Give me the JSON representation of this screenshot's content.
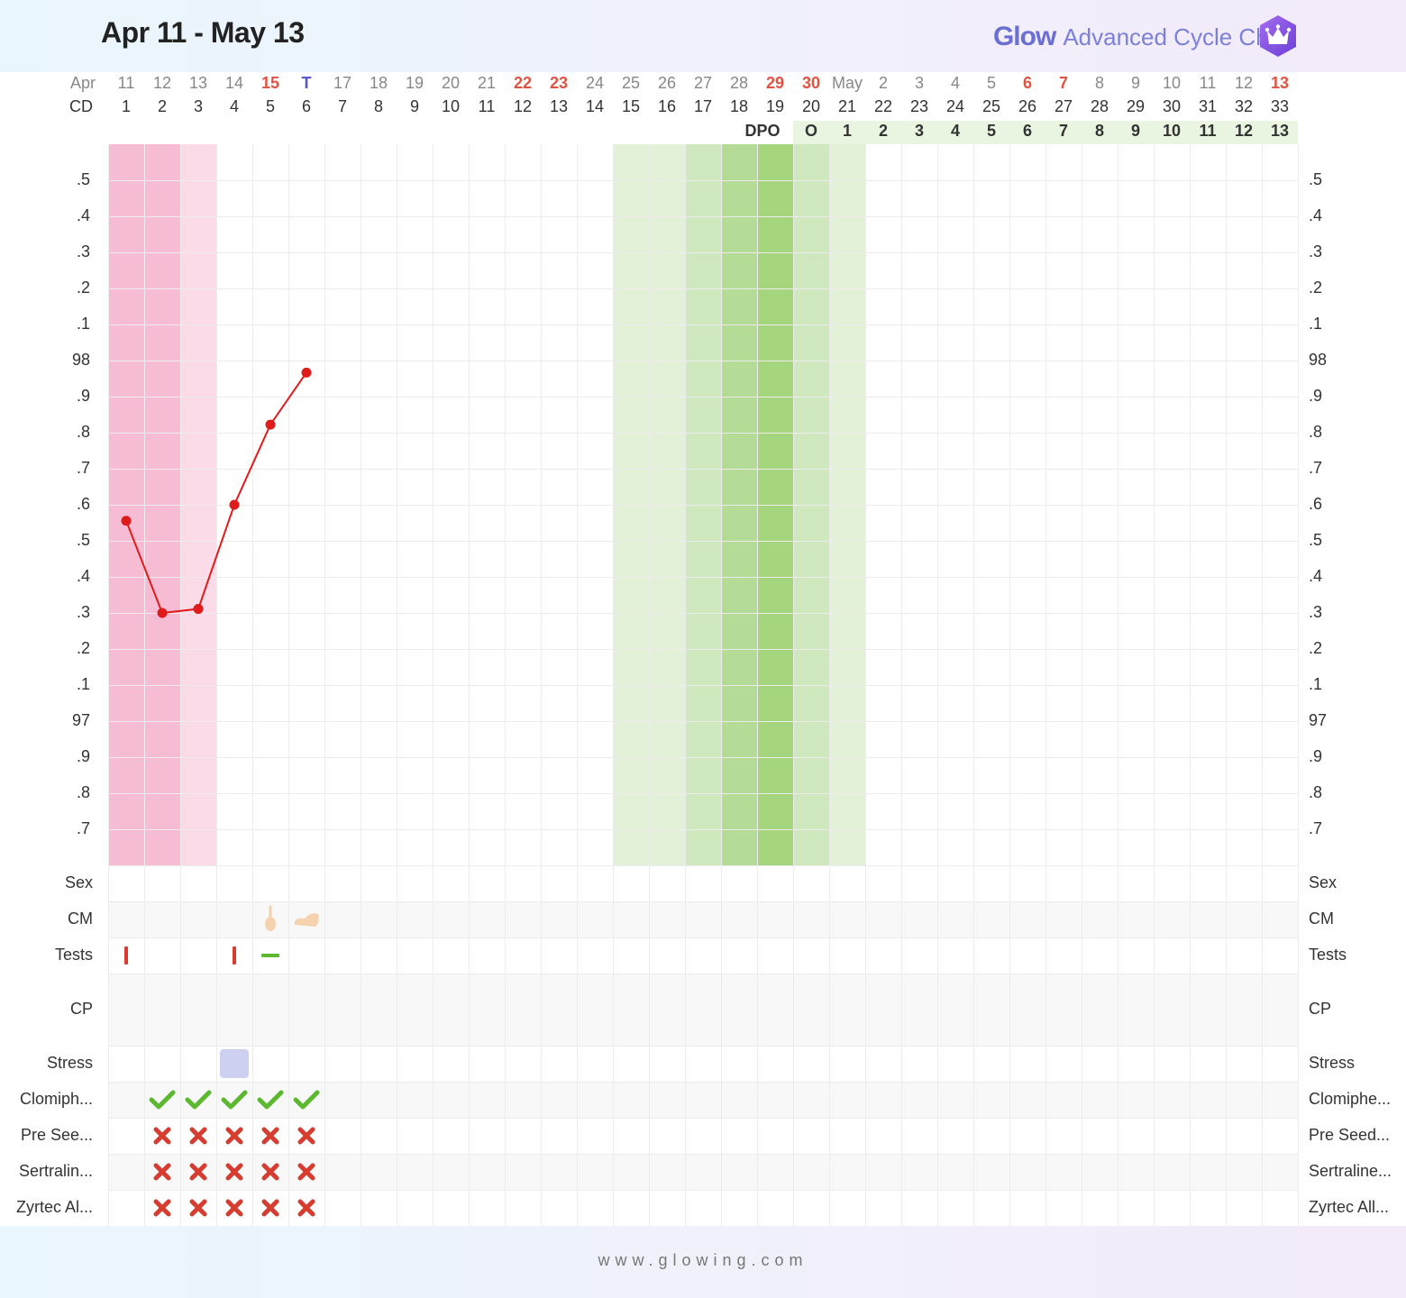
{
  "header": {
    "range_title": "Apr 11 - May 13",
    "brand_glow": "Glow",
    "brand_sub": "Advanced Cycle Chart",
    "crown_icon": "crown-icon"
  },
  "footer": {
    "url": "www.glowing.com"
  },
  "colors": {
    "period_heavy": "#f6bcd4",
    "period_light": "#fadbe7",
    "fertile_light": "#e2f1d7",
    "fertile_mid": "#cfe8be",
    "fertile_strong": "#b5dc97",
    "fertile_peak": "#a5d57d",
    "temp_line": "#e01b1b",
    "weekend_red": "#e05343",
    "today_blue": "#5555cc",
    "dpo_bg": "#eaf5e1",
    "check_green": "#5cb82f",
    "cross_red": "#d63c2f"
  },
  "chart_data": {
    "type": "line",
    "title": "Apr 11 - May 13",
    "row_labels": {
      "date": "Apr",
      "cd": "CD",
      "dpo": "DPO"
    },
    "dates": [
      "11",
      "12",
      "13",
      "14",
      "15",
      "T",
      "17",
      "18",
      "19",
      "20",
      "21",
      "22",
      "23",
      "24",
      "25",
      "26",
      "27",
      "28",
      "29",
      "30",
      "May",
      "2",
      "3",
      "4",
      "5",
      "6",
      "7",
      "8",
      "9",
      "10",
      "11",
      "12",
      "13"
    ],
    "date_styles": [
      "n",
      "n",
      "n",
      "n",
      "r",
      "b",
      "n",
      "n",
      "n",
      "n",
      "n",
      "r",
      "r",
      "n",
      "n",
      "n",
      "n",
      "n",
      "r",
      "r",
      "n",
      "n",
      "n",
      "n",
      "n",
      "r",
      "r",
      "n",
      "n",
      "n",
      "n",
      "n",
      "r"
    ],
    "cycle_days": [
      "1",
      "2",
      "3",
      "4",
      "5",
      "6",
      "7",
      "8",
      "9",
      "10",
      "11",
      "12",
      "13",
      "14",
      "15",
      "16",
      "17",
      "18",
      "19",
      "20",
      "21",
      "22",
      "23",
      "24",
      "25",
      "26",
      "27",
      "28",
      "29",
      "30",
      "31",
      "32",
      "33"
    ],
    "dpo_values": [
      "O",
      "1",
      "2",
      "3",
      "4",
      "5",
      "6",
      "7",
      "8",
      "9",
      "10",
      "11",
      "12",
      "13"
    ],
    "dpo_start_index": 19,
    "y_ticks": [
      ".5",
      ".4",
      ".3",
      ".2",
      ".1",
      "98",
      ".9",
      ".8",
      ".7",
      ".6",
      ".5",
      ".4",
      ".3",
      ".2",
      ".1",
      "97",
      ".9",
      ".8",
      ".7"
    ],
    "ylim": [
      96.7,
      98.5
    ],
    "temperatures": [
      {
        "day": 1,
        "value": 97.56
      },
      {
        "day": 2,
        "value": 97.33
      },
      {
        "day": 3,
        "value": 97.34
      },
      {
        "day": 4,
        "value": 97.6
      },
      {
        "day": 5,
        "value": 97.8
      },
      {
        "day": 6,
        "value": 97.93
      }
    ],
    "day_shading": [
      {
        "day": 1,
        "tone": "period_heavy"
      },
      {
        "day": 2,
        "tone": "period_heavy"
      },
      {
        "day": 3,
        "tone": "period_light"
      },
      {
        "day": 15,
        "tone": "fertile_light"
      },
      {
        "day": 16,
        "tone": "fertile_light"
      },
      {
        "day": 17,
        "tone": "fertile_mid"
      },
      {
        "day": 18,
        "tone": "fertile_strong"
      },
      {
        "day": 19,
        "tone": "fertile_peak"
      },
      {
        "day": 20,
        "tone": "fertile_mid"
      },
      {
        "day": 21,
        "tone": "fertile_light"
      }
    ],
    "grid": true
  },
  "symptoms": {
    "rows": [
      {
        "left": "Sex",
        "right": "Sex",
        "tall": false
      },
      {
        "left": "CM",
        "right": "CM",
        "tall": false
      },
      {
        "left": "Tests",
        "right": "Tests",
        "tall": false
      },
      {
        "left": "CP",
        "right": "CP",
        "tall": true
      },
      {
        "left": "Stress",
        "right": "Stress",
        "tall": false
      },
      {
        "left": "Clomiph...",
        "right": "Clomiphe...",
        "tall": false
      },
      {
        "left": "Pre See...",
        "right": "Pre Seed...",
        "tall": false
      },
      {
        "left": "Sertralin...",
        "right": "Sertraline...",
        "tall": false
      },
      {
        "left": "Zyrtec Al...",
        "right": "Zyrtec All...",
        "tall": false
      }
    ],
    "marks": [
      {
        "row": 1,
        "day": 5,
        "icon": "cervical-mucus-sticky-icon"
      },
      {
        "row": 1,
        "day": 6,
        "icon": "cervical-mucus-creamy-icon"
      },
      {
        "row": 2,
        "day": 1,
        "icon": "test-negative-red-bar-icon"
      },
      {
        "row": 2,
        "day": 4,
        "icon": "test-negative-red-bar-icon"
      },
      {
        "row": 2,
        "day": 5,
        "icon": "test-positive-green-bar-icon"
      },
      {
        "row": 4,
        "day": 4,
        "icon": "stress-level-icon"
      },
      {
        "row": 5,
        "day": 2,
        "icon": "check-icon"
      },
      {
        "row": 5,
        "day": 3,
        "icon": "check-icon"
      },
      {
        "row": 5,
        "day": 4,
        "icon": "check-icon"
      },
      {
        "row": 5,
        "day": 5,
        "icon": "check-icon"
      },
      {
        "row": 5,
        "day": 6,
        "icon": "check-icon"
      },
      {
        "row": 6,
        "day": 2,
        "icon": "cross-icon"
      },
      {
        "row": 6,
        "day": 3,
        "icon": "cross-icon"
      },
      {
        "row": 6,
        "day": 4,
        "icon": "cross-icon"
      },
      {
        "row": 6,
        "day": 5,
        "icon": "cross-icon"
      },
      {
        "row": 6,
        "day": 6,
        "icon": "cross-icon"
      },
      {
        "row": 7,
        "day": 2,
        "icon": "cross-icon"
      },
      {
        "row": 7,
        "day": 3,
        "icon": "cross-icon"
      },
      {
        "row": 7,
        "day": 4,
        "icon": "cross-icon"
      },
      {
        "row": 7,
        "day": 5,
        "icon": "cross-icon"
      },
      {
        "row": 7,
        "day": 6,
        "icon": "cross-icon"
      },
      {
        "row": 8,
        "day": 2,
        "icon": "cross-icon"
      },
      {
        "row": 8,
        "day": 3,
        "icon": "cross-icon"
      },
      {
        "row": 8,
        "day": 4,
        "icon": "cross-icon"
      },
      {
        "row": 8,
        "day": 5,
        "icon": "cross-icon"
      },
      {
        "row": 8,
        "day": 6,
        "icon": "cross-icon"
      }
    ]
  }
}
